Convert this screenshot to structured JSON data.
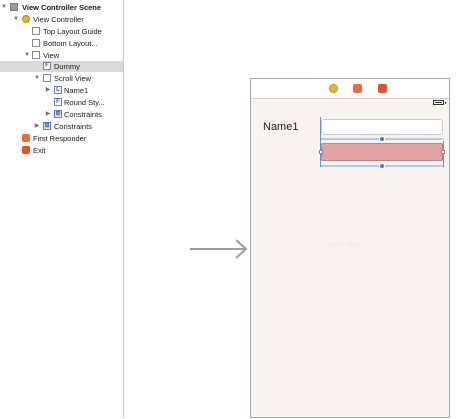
{
  "outline": {
    "items": [
      {
        "label": "View Controller Scene",
        "icon": "scene-icon"
      },
      {
        "label": "View Controller",
        "icon": "view-controller-icon"
      },
      {
        "label": "Top Layout Guide",
        "icon": "layout-guide-icon"
      },
      {
        "label": "Bottom Layout...",
        "icon": "layout-guide-icon"
      },
      {
        "label": "View",
        "icon": "view-icon"
      },
      {
        "label": "Dummy",
        "icon": "view-icon",
        "badge": "F",
        "selected": true
      },
      {
        "label": "Scroll View",
        "icon": "scroll-view-icon"
      },
      {
        "label": "Name1",
        "icon": "label-icon",
        "badge": "L"
      },
      {
        "label": "Round Sty...",
        "icon": "text-field-icon",
        "badge": "F"
      },
      {
        "label": "Constraints",
        "icon": "constraints-icon"
      },
      {
        "label": "Constraints",
        "icon": "constraints-icon"
      },
      {
        "label": "First Responder",
        "icon": "first-responder-icon"
      },
      {
        "label": "Exit",
        "icon": "exit-icon"
      }
    ]
  },
  "canvas": {
    "scene": {
      "label_text": "Name1",
      "ghost_text": "Scroll View",
      "text_field_placeholder": "",
      "dock_icons": [
        "view-controller-icon",
        "first-responder-icon",
        "exit-icon"
      ],
      "background_color": "#f7f3ef",
      "dummy_color": "#e3a3a6",
      "selection_color": "#3d7fd6"
    }
  }
}
